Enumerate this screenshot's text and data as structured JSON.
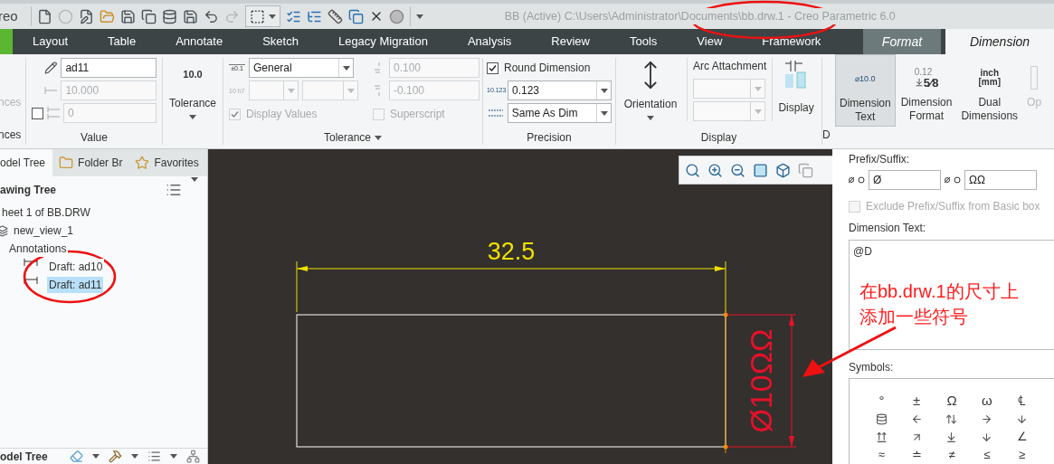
{
  "app": {
    "logo": "reo",
    "title": "BB (Active) C:\\Users\\Administrator\\Documents\\bb.drw.1 - Creo Parametric 6.0"
  },
  "ribbon_tabs": [
    {
      "label": "Layout",
      "kind": "normal",
      "selected": false
    },
    {
      "label": "Table",
      "kind": "normal",
      "selected": false
    },
    {
      "label": "Annotate",
      "kind": "normal",
      "selected": false
    },
    {
      "label": "Sketch",
      "kind": "normal",
      "selected": false
    },
    {
      "label": "Legacy Migration",
      "kind": "normal",
      "selected": false
    },
    {
      "label": "Analysis",
      "kind": "normal",
      "selected": false
    },
    {
      "label": "Review",
      "kind": "normal",
      "selected": false
    },
    {
      "label": "Tools",
      "kind": "normal",
      "selected": false
    },
    {
      "label": "View",
      "kind": "normal",
      "selected": false
    },
    {
      "label": "Framework",
      "kind": "normal",
      "selected": false
    },
    {
      "label": "Format",
      "kind": "contextual",
      "selected": false
    },
    {
      "label": "Dimension",
      "kind": "contextual",
      "selected": true
    }
  ],
  "ribbon": {
    "cut_group": {
      "button_label": "nces",
      "label": "nces"
    },
    "value": {
      "label": "Value",
      "name_field": "ad11",
      "value_field": {
        "value": "10.000",
        "disabled": true
      },
      "override": {
        "checked": false,
        "value": "0",
        "disabled": true
      }
    },
    "tolerance_button": {
      "icon_text": "10.0",
      "label": "Tolerance"
    },
    "tolerance": {
      "label": "Tolerance",
      "table_icon_text": "±0.1",
      "table": "General",
      "fit_icon_text": "10 h7",
      "fit_selects": [
        {
          "disabled": true
        },
        {
          "disabled": true
        }
      ],
      "display_values": {
        "label": "Display Values",
        "checked": true,
        "disabled": true
      },
      "upper": {
        "value": "0.100",
        "disabled": true
      },
      "lower": {
        "value": "-0.100",
        "disabled": true
      },
      "superscript": {
        "label": "Superscript",
        "checked": false,
        "disabled": true
      }
    },
    "precision": {
      "label": "Precision",
      "round": {
        "label": "Round Dimension",
        "checked": true
      },
      "decimals_icon_text": "10.123",
      "decimals": "0.123",
      "tolerance_decimals": "Same As Dim"
    },
    "display": {
      "label": "Display",
      "orientation": "Orientation",
      "arc_attachment": "Arc Attachment",
      "arc_selects": [
        {
          "disabled": true
        },
        {
          "disabled": true
        }
      ],
      "display_button": "Display"
    },
    "dimension": {
      "label_fragment": "D",
      "buttons": [
        {
          "kind": "dimension_text",
          "icon_text": [
            "⌀10.0"
          ],
          "label": "Dimension\nText",
          "selected": true,
          "disabled": false
        },
        {
          "kind": "dimension_format",
          "icon_text": [
            "0.12",
            "5⁄8"
          ],
          "label": "Dimension\nFormat",
          "selected": false,
          "disabled": false
        },
        {
          "kind": "dual",
          "icon_text": [
            "inch",
            "[mm]"
          ],
          "label": "Dual\nDimensions",
          "selected": false,
          "disabled": false
        },
        {
          "kind": "cut",
          "label": "Op",
          "selected": false,
          "disabled": true
        }
      ]
    }
  },
  "model_tree": {
    "tabs": [
      {
        "label": "odel Tree",
        "selected": true
      },
      {
        "label": "Folder Br",
        "selected": false
      },
      {
        "label": "Favorites",
        "selected": false
      }
    ],
    "header": "awing Tree",
    "items": [
      {
        "label": "heet 1 of BB.DRW",
        "selected": false,
        "children": [
          {
            "label": "new_view_1",
            "kind": "view",
            "selected": false,
            "children": [
              {
                "label": "Annotations",
                "selected": false,
                "children": [
                  {
                    "label": "Draft: ad10",
                    "kind": "dimension",
                    "selected": false
                  },
                  {
                    "label": "Draft: ad11",
                    "kind": "dimension",
                    "selected": true
                  }
                ]
              }
            ]
          }
        ]
      }
    ],
    "footer": "odel Tree"
  },
  "drawing": {
    "horizontal_dimension": "32.5",
    "vertical_dimension": "Ø10ΩΩ"
  },
  "dimension_panel": {
    "prefix_suffix_label": "Prefix/Suffix:",
    "prefix": "Ø",
    "suffix": "ΩΩ",
    "exclude": {
      "label": "Exclude Prefix/Suffix from Basic box",
      "checked": false,
      "disabled": true
    },
    "dimension_text_label": "Dimension Text:",
    "dimension_text": "@D",
    "symbols_label": "Symbols:",
    "symbols": [
      {
        "kind": "char",
        "text": "°"
      },
      {
        "kind": "char",
        "text": "±"
      },
      {
        "kind": "char",
        "text": "Ω"
      },
      {
        "kind": "char",
        "text": "ω"
      },
      {
        "kind": "char",
        "text": "℄"
      },
      {
        "kind": "icon"
      },
      {
        "kind": "icon"
      },
      {
        "kind": "icon"
      },
      {
        "kind": "icon"
      },
      {
        "kind": "icon"
      },
      {
        "kind": "icon"
      },
      {
        "kind": "icon"
      },
      {
        "kind": "icon"
      },
      {
        "kind": "icon"
      },
      {
        "kind": "char",
        "text": "∠"
      },
      {
        "kind": "char",
        "text": "≈"
      },
      {
        "kind": "char",
        "text": "≐"
      },
      {
        "kind": "char",
        "text": "≠"
      },
      {
        "kind": "char",
        "text": "≤"
      },
      {
        "kind": "char",
        "text": "≥"
      }
    ]
  },
  "annotation": {
    "note": "在bb.drw.1的尺寸上添加一些符号"
  }
}
